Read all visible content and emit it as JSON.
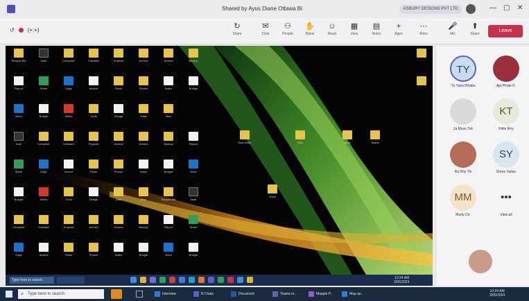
{
  "window": {
    "title": "Shared by Ayus Diane Ottawa Bi",
    "org": "ASBURY DESIGNS PVT LTD",
    "controls": [
      "—",
      "▢",
      "✕"
    ]
  },
  "toolbar": {
    "timer": "(+:+)",
    "buttons": [
      {
        "label": "Share",
        "icon": "↻",
        "name": "share-icon"
      },
      {
        "label": "Chat",
        "icon": "✉",
        "name": "chat-icon"
      },
      {
        "label": "People",
        "icon": "⚇",
        "name": "people-icon"
      },
      {
        "label": "Raise",
        "icon": "✋",
        "name": "raise-hand-icon"
      },
      {
        "label": "React",
        "icon": "☺",
        "name": "react-icon"
      },
      {
        "label": "View",
        "icon": "▦",
        "name": "view-icon"
      },
      {
        "label": "Notes",
        "icon": "▤",
        "name": "notes-icon"
      },
      {
        "label": "Apps",
        "icon": "+",
        "name": "apps-icon"
      },
      {
        "label": "More",
        "icon": "⋯",
        "name": "more-icon"
      },
      {
        "label": "Mic",
        "icon": "🎤",
        "name": "mic-icon"
      },
      {
        "label": "Share",
        "icon": "⬆",
        "name": "share-tray-icon"
      }
    ],
    "leave_label": "Leave"
  },
  "desktop": {
    "icons": [
      {
        "label": "Recycle Bin",
        "kind": "folder"
      },
      {
        "label": "Note",
        "kind": "dark"
      },
      {
        "label": "Computer",
        "kind": "folder"
      },
      {
        "label": "Software",
        "kind": "folder"
      },
      {
        "label": "Projects",
        "kind": "folder"
      },
      {
        "label": "Archive",
        "kind": "folder"
      },
      {
        "label": "Drivers",
        "kind": "folder"
      },
      {
        "label": "Backup",
        "kind": "folder"
      },
      {
        "label": "Report",
        "kind": "doc"
      },
      {
        "label": "Sheet",
        "kind": "green"
      },
      {
        "label": "Edge",
        "kind": "blue"
      },
      {
        "label": "Invoice",
        "kind": "doc"
      },
      {
        "label": "Plans",
        "kind": "folder"
      },
      {
        "label": "Photos",
        "kind": "folder"
      },
      {
        "label": "Notes",
        "kind": "doc"
      },
      {
        "label": "Budget",
        "kind": "doc"
      },
      {
        "label": "Word",
        "kind": "blue"
      },
      {
        "label": "Budget",
        "kind": "doc"
      },
      {
        "label": "Slides",
        "kind": "red"
      },
      {
        "label": "Tools",
        "kind": "folder"
      },
      {
        "label": "Design",
        "kind": "doc"
      },
      {
        "label": "Data",
        "kind": "folder"
      },
      {
        "label": "Misc",
        "kind": "folder"
      }
    ],
    "scattered": [
      {
        "label": "New folder"
      },
      {
        "label": "Files"
      },
      {
        "label": "Temp"
      },
      {
        "label": "Scans"
      },
      {
        "label": "Docs"
      }
    ]
  },
  "inner_taskbar": {
    "search": "Type here to search",
    "clock": "10:24 AM",
    "date": "3/05/2024"
  },
  "participants": {
    "tiles": [
      {
        "initials": "TY",
        "name": "Tu Yansi Bhatia",
        "bg": "#c9dbef",
        "color": "#2b4466",
        "ring": true
      },
      {
        "initials": "",
        "name": "Apt Pirate K.",
        "bg": "#9b2f3a",
        "color": "#ffffff"
      },
      {
        "initials": "",
        "name": "Ja Myas Tuk",
        "bg": "#d9d9d9",
        "color": "#333333"
      },
      {
        "initials": "KT",
        "name": "Kittie Roy",
        "bg": "#e4ecd9",
        "color": "#4a5d2b"
      },
      {
        "initials": "",
        "name": "Ra Roy Tin",
        "bg": "#b56b55",
        "color": "#ffffff"
      },
      {
        "initials": "SY",
        "name": "Shree Yadav",
        "bg": "#d8e6ee",
        "color": "#2b4466"
      },
      {
        "initials": "MM",
        "name": "Murty Ch.",
        "bg": "#f3e3c8",
        "color": "#7a5a24"
      },
      {
        "initials": "•••",
        "name": "View all",
        "bg": "#f4f4f6",
        "color": "#333333"
      }
    ]
  },
  "taskbar": {
    "search_placeholder": "Type here to search",
    "apps": [
      {
        "label": "Interview",
        "color": "#2b7cd3"
      },
      {
        "label": "N Chats",
        "color": "#5b5fc7"
      },
      {
        "label": "Document",
        "color": "#2b579a"
      },
      {
        "label": "Teams m..",
        "color": "#6264a7"
      },
      {
        "label": "Mappin P..",
        "color": "#8b5fbf"
      },
      {
        "label": "Map qn..",
        "color": "#3a7bd5"
      }
    ],
    "clock": "10:24 AM",
    "date": "3/05/2024"
  }
}
